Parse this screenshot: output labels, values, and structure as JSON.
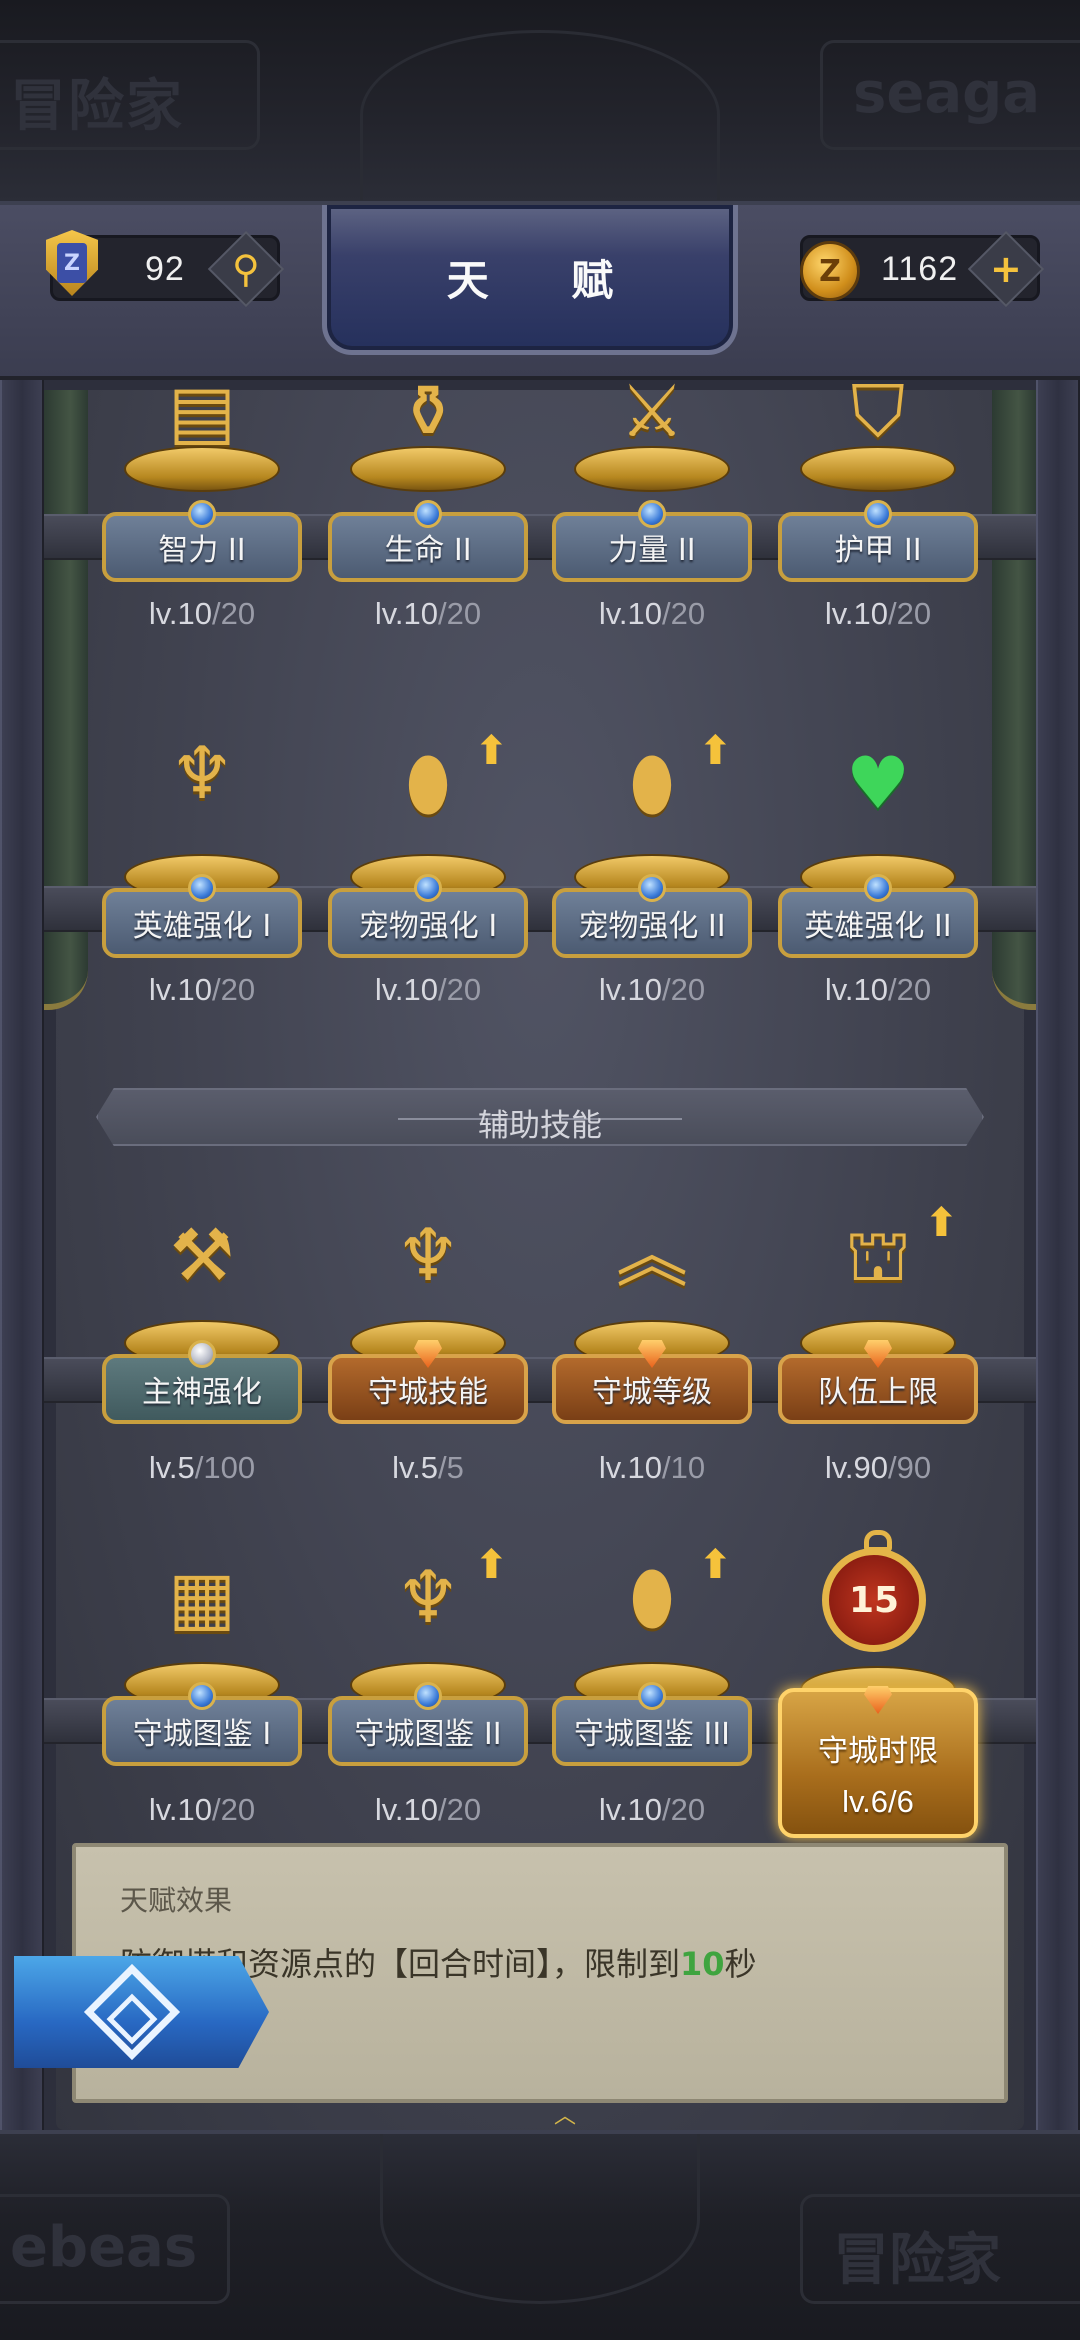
{
  "header": {
    "title": "天 赋",
    "badge_value": "92",
    "coin_value": "1162",
    "badge_glyph": "Z",
    "coin_glyph": "Z",
    "search_label": "⚲",
    "add_label": "+"
  },
  "deco": {
    "top_left": "冒险家",
    "top_right": "seaga",
    "bottom_left": "ebeas",
    "bottom_right": "冒险家"
  },
  "talents_row1": [
    {
      "name": "智力 II",
      "level": "lv.10",
      "max": "/20",
      "icon": "book-icon"
    },
    {
      "name": "生命 II",
      "level": "lv.10",
      "max": "/20",
      "icon": "vase-icon"
    },
    {
      "name": "力量 II",
      "level": "lv.10",
      "max": "/20",
      "icon": "sword-icon"
    },
    {
      "name": "护甲 II",
      "level": "lv.10",
      "max": "/20",
      "icon": "shield-icon"
    }
  ],
  "talents_row2": [
    {
      "name": "英雄强化 I",
      "level": "lv.10",
      "max": "/20",
      "icon": "sword-crest-icon"
    },
    {
      "name": "宠物强化 I",
      "level": "lv.10",
      "max": "/20",
      "icon": "egg-icon"
    },
    {
      "name": "宠物强化 II",
      "level": "lv.10",
      "max": "/20",
      "icon": "egg-leaf-icon"
    },
    {
      "name": "英雄强化 II",
      "level": "lv.10",
      "max": "/20",
      "icon": "green-heart-icon"
    }
  ],
  "section": {
    "title": "辅助技能"
  },
  "talents_row3": [
    {
      "name": "主神强化",
      "level": "lv.5",
      "max": "/100",
      "icon": "hammer-icon"
    },
    {
      "name": "守城技能",
      "level": "lv.5",
      "max": "/5",
      "icon": "trident-icon"
    },
    {
      "name": "守城等级",
      "level": "lv.10",
      "max": "/10",
      "icon": "rank-chevron-icon"
    },
    {
      "name": "队伍上限",
      "level": "lv.90",
      "max": "/90",
      "icon": "helmets-icon"
    }
  ],
  "talents_row4": [
    {
      "name": "守城图鉴 I",
      "level": "lv.10",
      "max": "/20",
      "icon": "book-net-icon"
    },
    {
      "name": "守城图鉴 II",
      "level": "lv.10",
      "max": "/20",
      "icon": "book-trident-icon"
    },
    {
      "name": "守城图鉴 III",
      "level": "lv.10",
      "max": "/20",
      "icon": "book-egg-icon"
    },
    {
      "name": "守城时限",
      "level": "lv.6/6",
      "timer": "15",
      "icon": "stopwatch-icon"
    }
  ],
  "effect": {
    "title": "天赋效果",
    "desc_prefix": "防御塔和资源点的【回合时间】，限制到",
    "desc_value": "10",
    "desc_suffix": "秒"
  },
  "colors": {
    "accent_gold": "#e3b34a",
    "highlight_green": "#3fa43f",
    "plate_blue": "#4c5b72",
    "plate_bronze": "#7a3f16"
  }
}
